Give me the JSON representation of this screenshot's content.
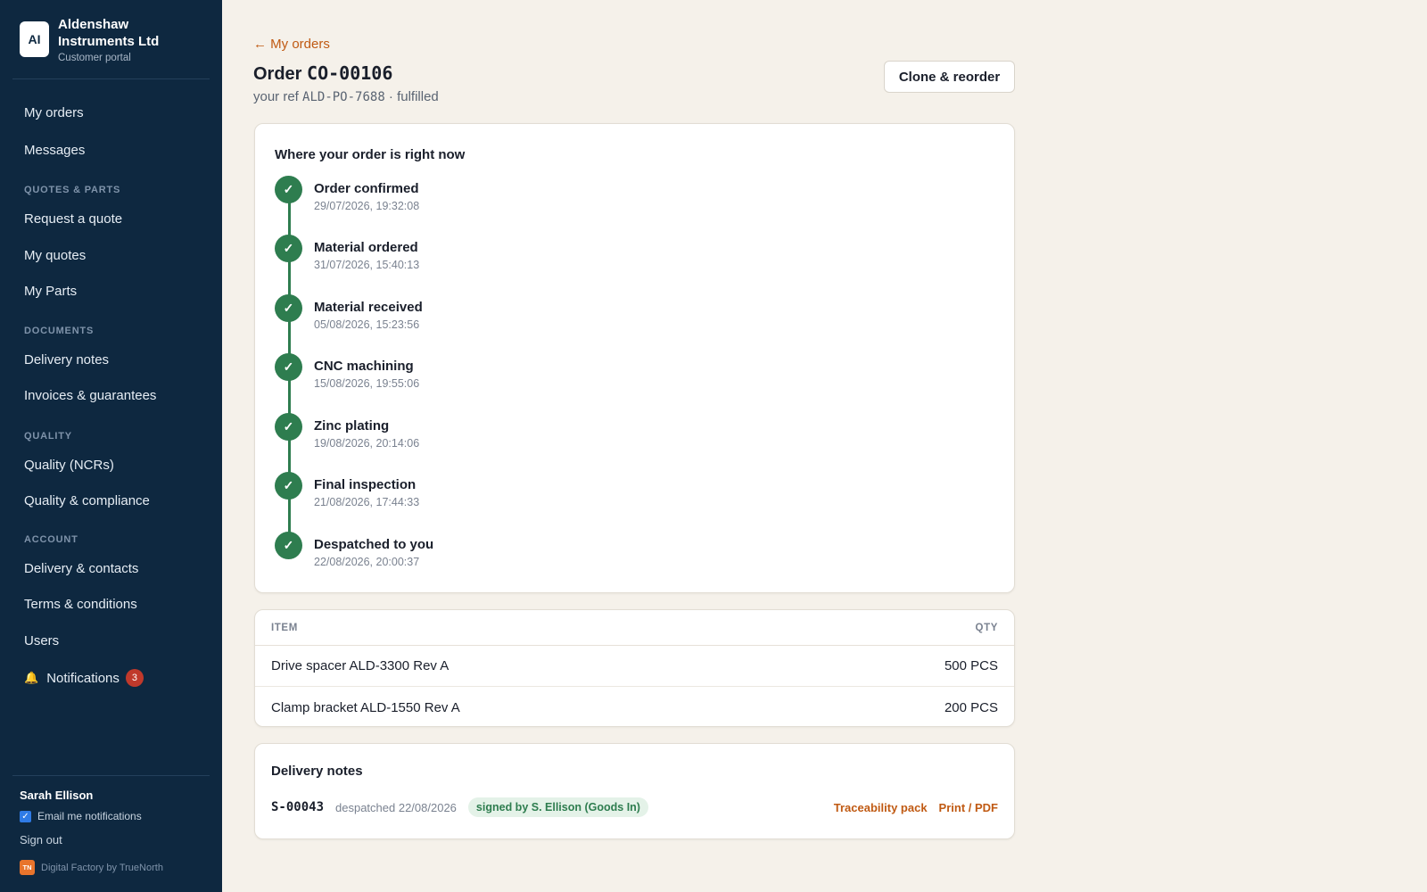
{
  "brand": {
    "logo_text": "AI",
    "name": "Aldenshaw Instruments Ltd",
    "subtitle": "Customer portal"
  },
  "nav": {
    "my_orders": "My orders",
    "messages": "Messages",
    "section_quotes": "QUOTES & PARTS",
    "request_quote": "Request a quote",
    "my_quotes": "My quotes",
    "my_parts": "My Parts",
    "section_documents": "DOCUMENTS",
    "delivery_notes": "Delivery notes",
    "invoices": "Invoices & guarantees",
    "section_quality": "QUALITY",
    "quality_ncrs": "Quality (NCRs)",
    "quality_compliance": "Quality & compliance",
    "section_account": "ACCOUNT",
    "delivery_contacts": "Delivery & contacts",
    "terms": "Terms & conditions",
    "users": "Users",
    "notifications": "Notifications",
    "notifications_count": "3"
  },
  "user": {
    "name": "Sarah Ellison",
    "email_opt": "Email me notifications",
    "email_opt_checked": true,
    "sign_out": "Sign out"
  },
  "footer": {
    "logo_text": "TN",
    "text": "Digital Factory by TrueNorth"
  },
  "header": {
    "back_link": "← My orders",
    "order_prefix": "Order",
    "order_id": "CO-00106",
    "ref_prefix": "your ref",
    "ref_id": "ALD-PO-7688",
    "status": "· fulfilled",
    "clone_button": "Clone & reorder"
  },
  "timeline": {
    "heading": "Where your order is right now",
    "steps": [
      {
        "title": "Order confirmed",
        "time": "29/07/2026, 19:32:08"
      },
      {
        "title": "Material ordered",
        "time": "31/07/2026, 15:40:13"
      },
      {
        "title": "Material received",
        "time": "05/08/2026, 15:23:56"
      },
      {
        "title": "CNC machining",
        "time": "15/08/2026, 19:55:06"
      },
      {
        "title": "Zinc plating",
        "time": "19/08/2026, 20:14:06"
      },
      {
        "title": "Final inspection",
        "time": "21/08/2026, 17:44:33"
      },
      {
        "title": "Despatched to you",
        "time": "22/08/2026, 20:00:37"
      }
    ]
  },
  "items": {
    "col_item": "ITEM",
    "col_qty": "QTY",
    "rows": [
      {
        "name": "Drive spacer ALD-3300 Rev A",
        "qty": "500 PCS"
      },
      {
        "name": "Clamp bracket ALD-1550 Rev A",
        "qty": "200 PCS"
      }
    ]
  },
  "delivery_notes": {
    "heading": "Delivery notes",
    "note_id": "S-00043",
    "date": "despatched 22/08/2026",
    "badge": "signed by S. Ellison (Goods In)",
    "traceability": "Traceability pack",
    "print": "Print / PDF"
  },
  "colors": {
    "sidebar": "#0e2840",
    "accent": "#c05a13",
    "success": "#2e7d4f",
    "badge": "#c0392b"
  }
}
